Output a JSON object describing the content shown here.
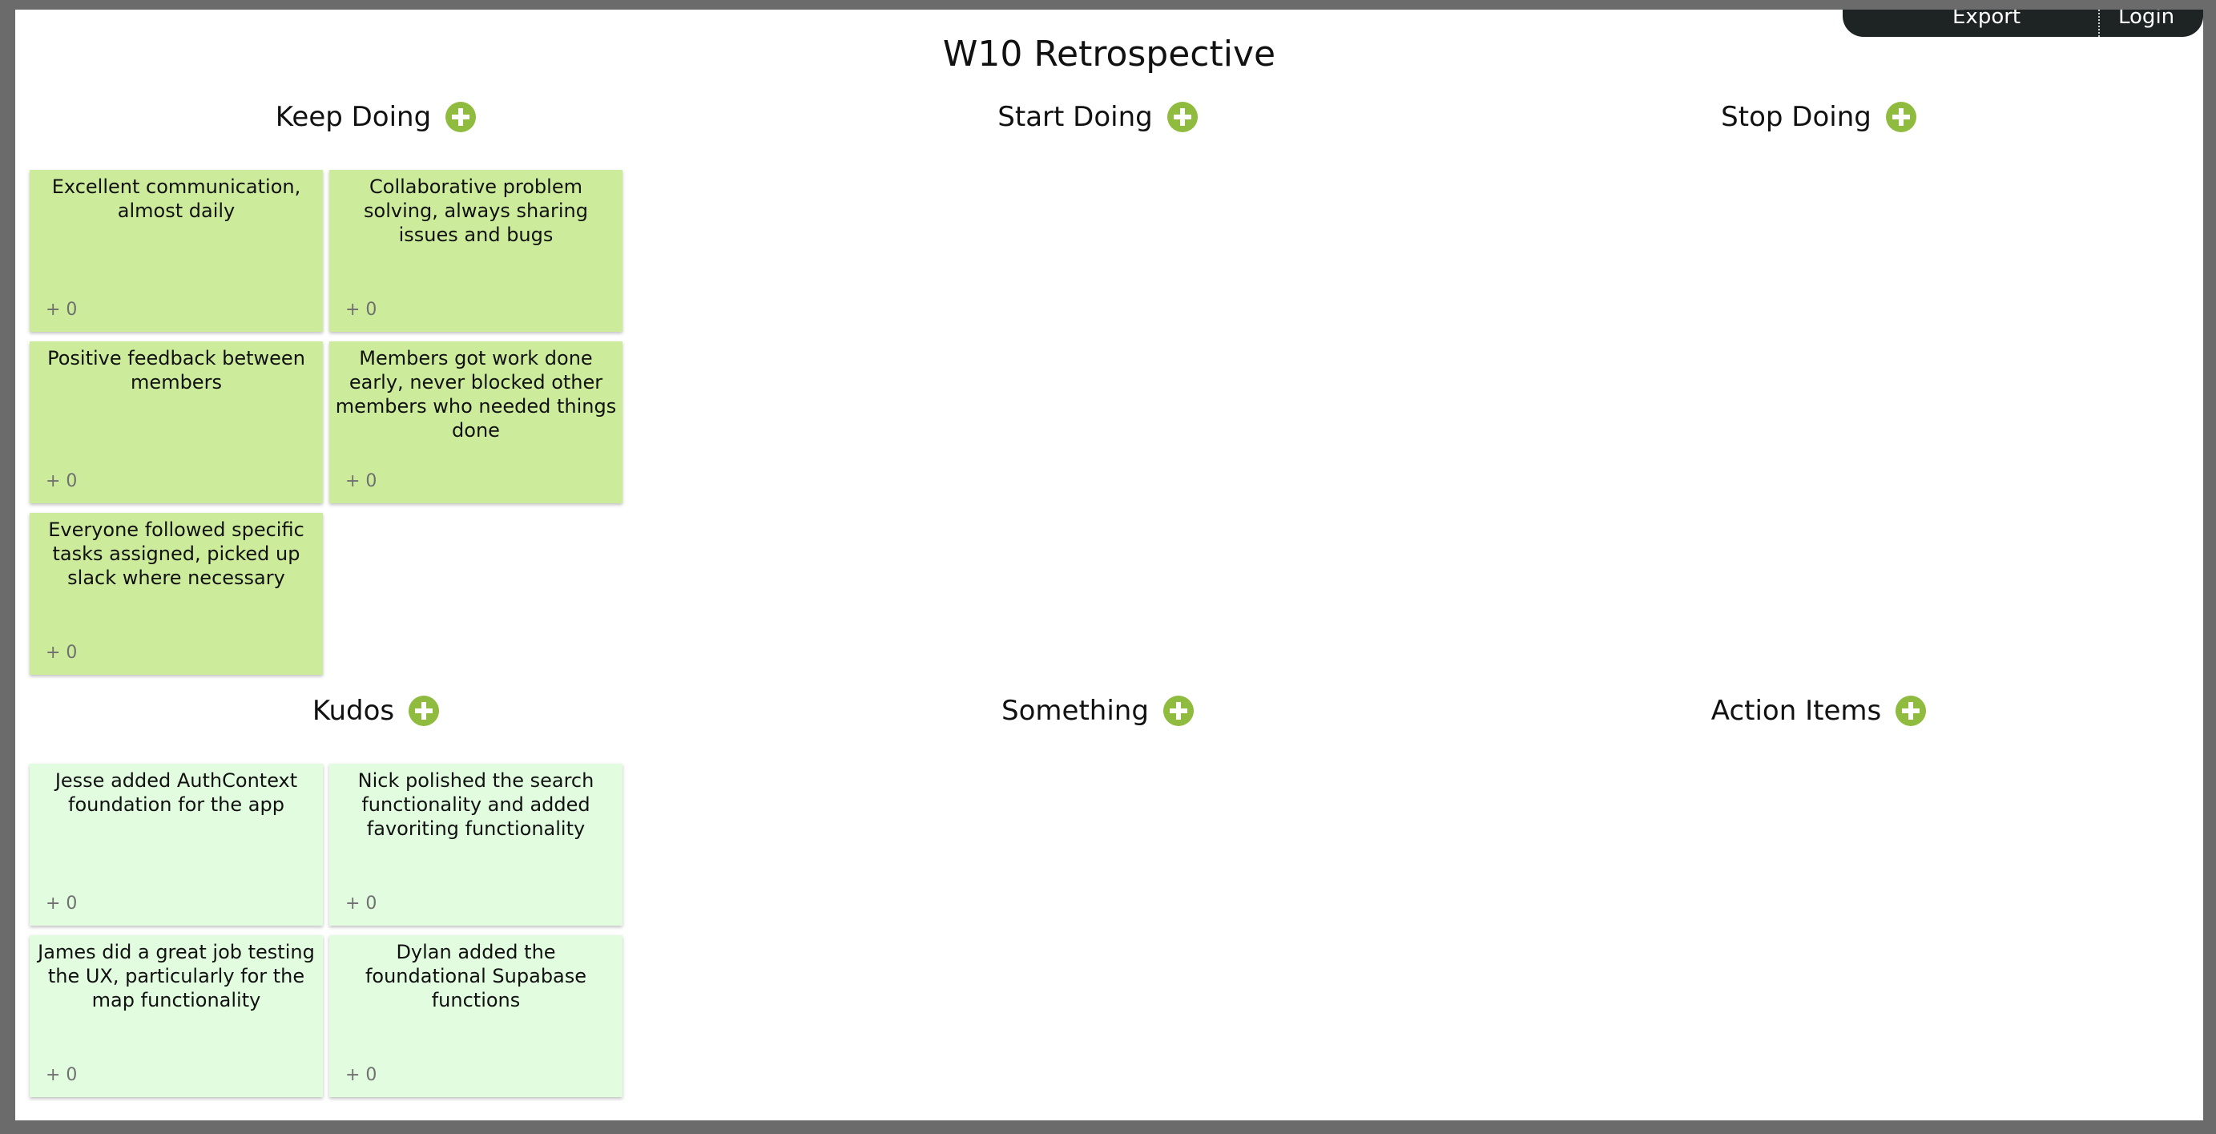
{
  "topbar": {
    "export_label": "Export",
    "login_label": "Login"
  },
  "title": "W10 Retrospective",
  "columns": [
    {
      "label": "Keep Doing"
    },
    {
      "label": "Start Doing"
    },
    {
      "label": "Stop Doing"
    },
    {
      "label": "Kudos"
    },
    {
      "label": "Something"
    },
    {
      "label": "Action Items"
    }
  ],
  "keep_doing": [
    {
      "text": "Excellent communication, almost daily",
      "votes": "+ 0"
    },
    {
      "text": "Collaborative problem solving, always sharing issues and bugs",
      "votes": "+ 0"
    },
    {
      "text": "Positive feedback between members",
      "votes": "+ 0"
    },
    {
      "text": "Members got work done early, never blocked other members who needed things done",
      "votes": "+ 0"
    },
    {
      "text": "Everyone followed specific tasks assigned, picked up slack where necessary",
      "votes": "+ 0"
    }
  ],
  "kudos": [
    {
      "text": "Jesse added AuthContext foundation for the app",
      "votes": "+ 0"
    },
    {
      "text": "Nick polished the search functionality and added favoriting functionality",
      "votes": "+ 0"
    },
    {
      "text": "James did a great job testing the UX, particularly for the map functionality",
      "votes": "+ 0"
    },
    {
      "text": "Dylan added the foundational Supabase functions",
      "votes": "+ 0"
    }
  ],
  "colors": {
    "add_icon": "#8fbb3e",
    "card_green": "#ccec9b",
    "card_mint": "#e2fce0",
    "topbar": "#1e2424"
  }
}
